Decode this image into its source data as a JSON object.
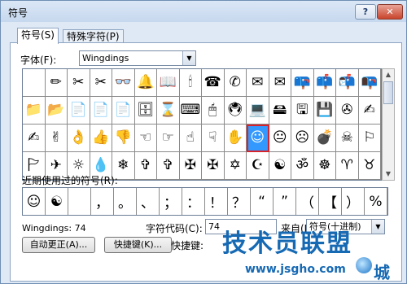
{
  "window": {
    "title": "符号",
    "help_label": "?",
    "close_label": "✕"
  },
  "tabs": [
    {
      "label": "符号(S)"
    },
    {
      "label": "特殊字符(P)"
    }
  ],
  "font": {
    "label": "字体(F):",
    "value": "Wingdings"
  },
  "grid": {
    "symbols": [
      " ",
      "✏",
      "✂",
      "✂",
      "👓",
      "🔔",
      "📖",
      "🕯",
      "☎",
      "✆",
      "✉",
      "✉",
      "📪",
      "📫",
      "📬",
      "📭",
      "📁",
      "📂",
      "📄",
      "📄",
      "📄",
      "🗄",
      "⌛",
      "⌨",
      "🖱",
      "🖲",
      "💻",
      "🖴",
      "🖫",
      "💾",
      "✇",
      "✍",
      "✍",
      "✌",
      "👌",
      "👍",
      "👎",
      "☜",
      "☞",
      "☝",
      "☟",
      "✋",
      "☺",
      "😐",
      "☹",
      "💣",
      "☠",
      "⚐",
      "🏱",
      "✈",
      "☼",
      "💧",
      "❄",
      "✞",
      "✞",
      "✠",
      "✠",
      "✡",
      "☪",
      "☯",
      "ॐ",
      "☸",
      "♈",
      "♉"
    ],
    "selected_index": 42,
    "selected_code": 74
  },
  "recent": {
    "label": "近期使用过的符号(R):",
    "symbols": [
      "☺",
      "☯",
      "",
      "，",
      "。",
      "、",
      "；",
      "：",
      "！",
      "？",
      "“",
      "”",
      "（",
      "【",
      "）",
      "%"
    ]
  },
  "code": {
    "info": "Wingdings: 74",
    "label": "字符代码(C):",
    "value": "74",
    "from_label": "来自(M):",
    "from_value": "符号(十进制)"
  },
  "buttons": {
    "autocorrect": "自动更正(A)...",
    "shortcut": "快捷键(K)...",
    "shortcut_label": "快捷键:"
  },
  "watermark": {
    "main": "技术员联盟",
    "url": "www.jsgho.com",
    "tail": "城"
  }
}
